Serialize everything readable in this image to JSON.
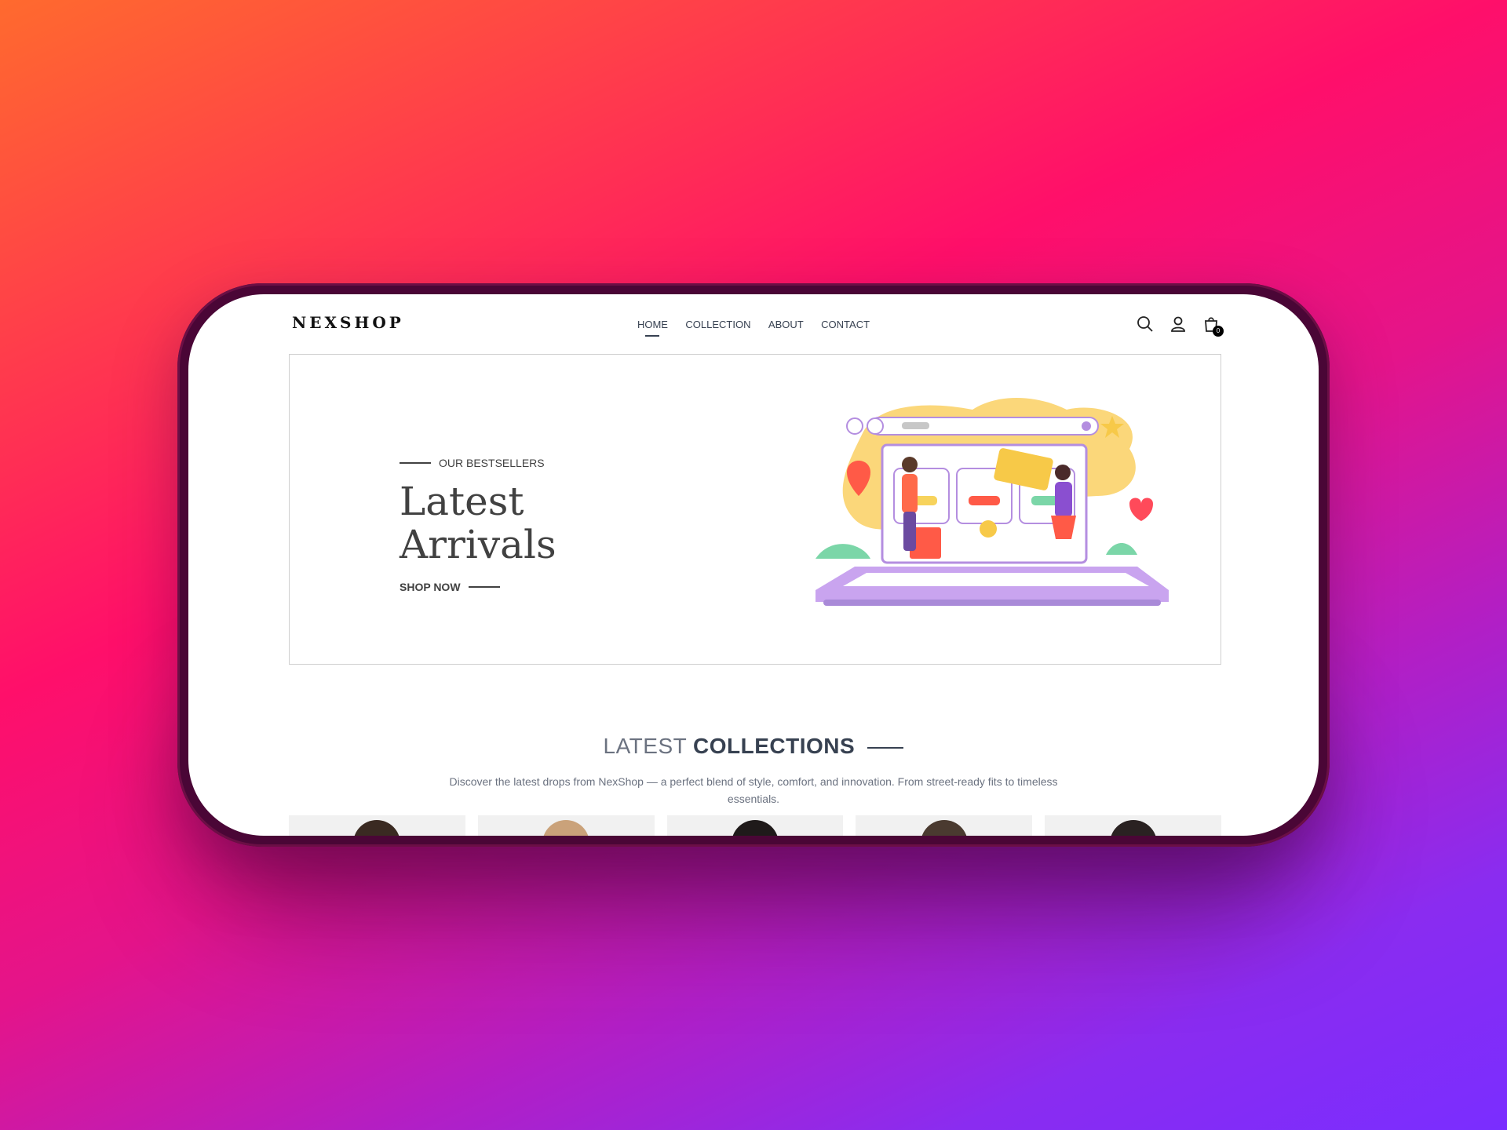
{
  "nav": {
    "logo": "NEXSHOP",
    "links": [
      "HOME",
      "COLLECTION",
      "ABOUT",
      "CONTACT"
    ],
    "cart_count": "0"
  },
  "hero": {
    "tagline": "OUR BESTSELLERS",
    "title": "Latest Arrivals",
    "cta": "SHOP NOW"
  },
  "collections": {
    "title_light": "LATEST",
    "title_bold": "COLLECTIONS",
    "description": "Discover the latest drops from NexShop — a perfect blend of style, comfort, and innovation. From street-ready fits to timeless essentials."
  },
  "icons": [
    "search-icon",
    "user-icon",
    "cart-icon"
  ],
  "colors": {
    "text": "#414141",
    "accent_purple": "#b48ee0",
    "accent_yellow": "#f7c948"
  }
}
